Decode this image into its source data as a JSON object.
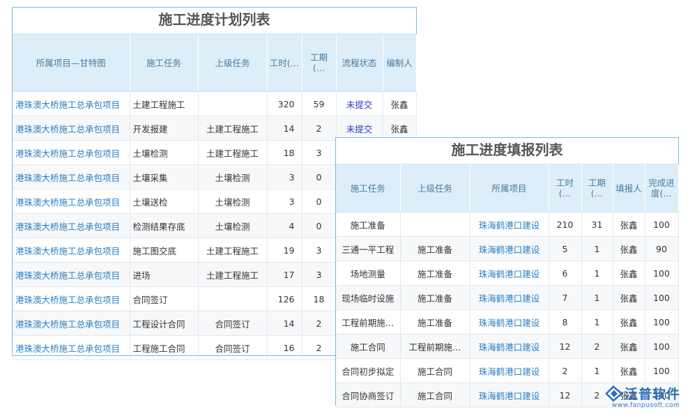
{
  "plan": {
    "title": "施工进度计划列表",
    "headers": [
      "所属项目—甘特图",
      "施工任务",
      "上级任务",
      "工时(…",
      "工期(…",
      "流程状态",
      "编制人"
    ],
    "rows": [
      {
        "project": "港珠澳大桥施工总承包项目",
        "task": "土建工程施工",
        "parent": "",
        "hours": "320",
        "days": "59",
        "status": "未提交",
        "owner": "张鑫"
      },
      {
        "project": "港珠澳大桥施工总承包项目",
        "task": "开发报建",
        "parent": "土建工程施工",
        "hours": "14",
        "days": "2",
        "status": "未提交",
        "owner": "张鑫"
      },
      {
        "project": "港珠澳大桥施工总承包项目",
        "task": "土壤检测",
        "parent": "土建工程施工",
        "hours": "18",
        "days": "3",
        "status": "",
        "owner": ""
      },
      {
        "project": "港珠澳大桥施工总承包项目",
        "task": "土壤采集",
        "parent": "土壤检测",
        "hours": "3",
        "days": "0",
        "status": "",
        "owner": ""
      },
      {
        "project": "港珠澳大桥施工总承包项目",
        "task": "土壤送检",
        "parent": "土壤检测",
        "hours": "3",
        "days": "0",
        "status": "",
        "owner": ""
      },
      {
        "project": "港珠澳大桥施工总承包项目",
        "task": "检测结果存底",
        "parent": "土壤检测",
        "hours": "4",
        "days": "0",
        "status": "",
        "owner": ""
      },
      {
        "project": "港珠澳大桥施工总承包项目",
        "task": "施工图交底",
        "parent": "土建工程施工",
        "hours": "19",
        "days": "3",
        "status": "",
        "owner": ""
      },
      {
        "project": "港珠澳大桥施工总承包项目",
        "task": "进场",
        "parent": "土建工程施工",
        "hours": "17",
        "days": "3",
        "status": "",
        "owner": ""
      },
      {
        "project": "港珠澳大桥施工总承包项目",
        "task": "合同签订",
        "parent": "",
        "hours": "126",
        "days": "18",
        "status": "",
        "owner": ""
      },
      {
        "project": "港珠澳大桥施工总承包项目",
        "task": "工程设计合同",
        "parent": "合同签订",
        "hours": "14",
        "days": "2",
        "status": "",
        "owner": ""
      },
      {
        "project": "港珠澳大桥施工总承包项目",
        "task": "工程施工合同",
        "parent": "合同签订",
        "hours": "16",
        "days": "2",
        "status": "",
        "owner": ""
      }
    ]
  },
  "report": {
    "title": "施工进度填报列表",
    "headers": [
      "施工任务",
      "上级任务",
      "所属项目",
      "工时(…",
      "工期(…",
      "填报人",
      "完成进度(…"
    ],
    "rows": [
      {
        "task": "施工准备",
        "parent": "",
        "project": "珠海鹤港口建设",
        "hours": "210",
        "days": "31",
        "reporter": "张鑫",
        "progress": "100"
      },
      {
        "task": "三通一平工程",
        "parent": "施工准备",
        "project": "珠海鹤港口建设",
        "hours": "5",
        "days": "1",
        "reporter": "张鑫",
        "progress": "90"
      },
      {
        "task": "场地测量",
        "parent": "施工准备",
        "project": "珠海鹤港口建设",
        "hours": "6",
        "days": "1",
        "reporter": "张鑫",
        "progress": "100"
      },
      {
        "task": "现场临时设施",
        "parent": "施工准备",
        "project": "珠海鹤港口建设",
        "hours": "7",
        "days": "1",
        "reporter": "张鑫",
        "progress": "100"
      },
      {
        "task": "工程前期施…",
        "parent": "施工准备",
        "project": "珠海鹤港口建设",
        "hours": "8",
        "days": "1",
        "reporter": "张鑫",
        "progress": "100"
      },
      {
        "task": "施工合同",
        "parent": "工程前期施…",
        "project": "珠海鹤港口建设",
        "hours": "12",
        "days": "2",
        "reporter": "张鑫",
        "progress": "100"
      },
      {
        "task": "合同初步拟定",
        "parent": "施工合同",
        "project": "珠海鹤港口建设",
        "hours": "2",
        "days": "1",
        "reporter": "张鑫",
        "progress": "100"
      },
      {
        "task": "合同协商签订",
        "parent": "施工合同",
        "project": "珠海鹤港口建设",
        "hours": "12",
        "days": "2",
        "reporter": "张鑫",
        "progress": "100"
      }
    ]
  },
  "logo": {
    "name": "泛普软件",
    "url": "www.fanpusoft.com",
    "color": "#2d6fb8"
  }
}
